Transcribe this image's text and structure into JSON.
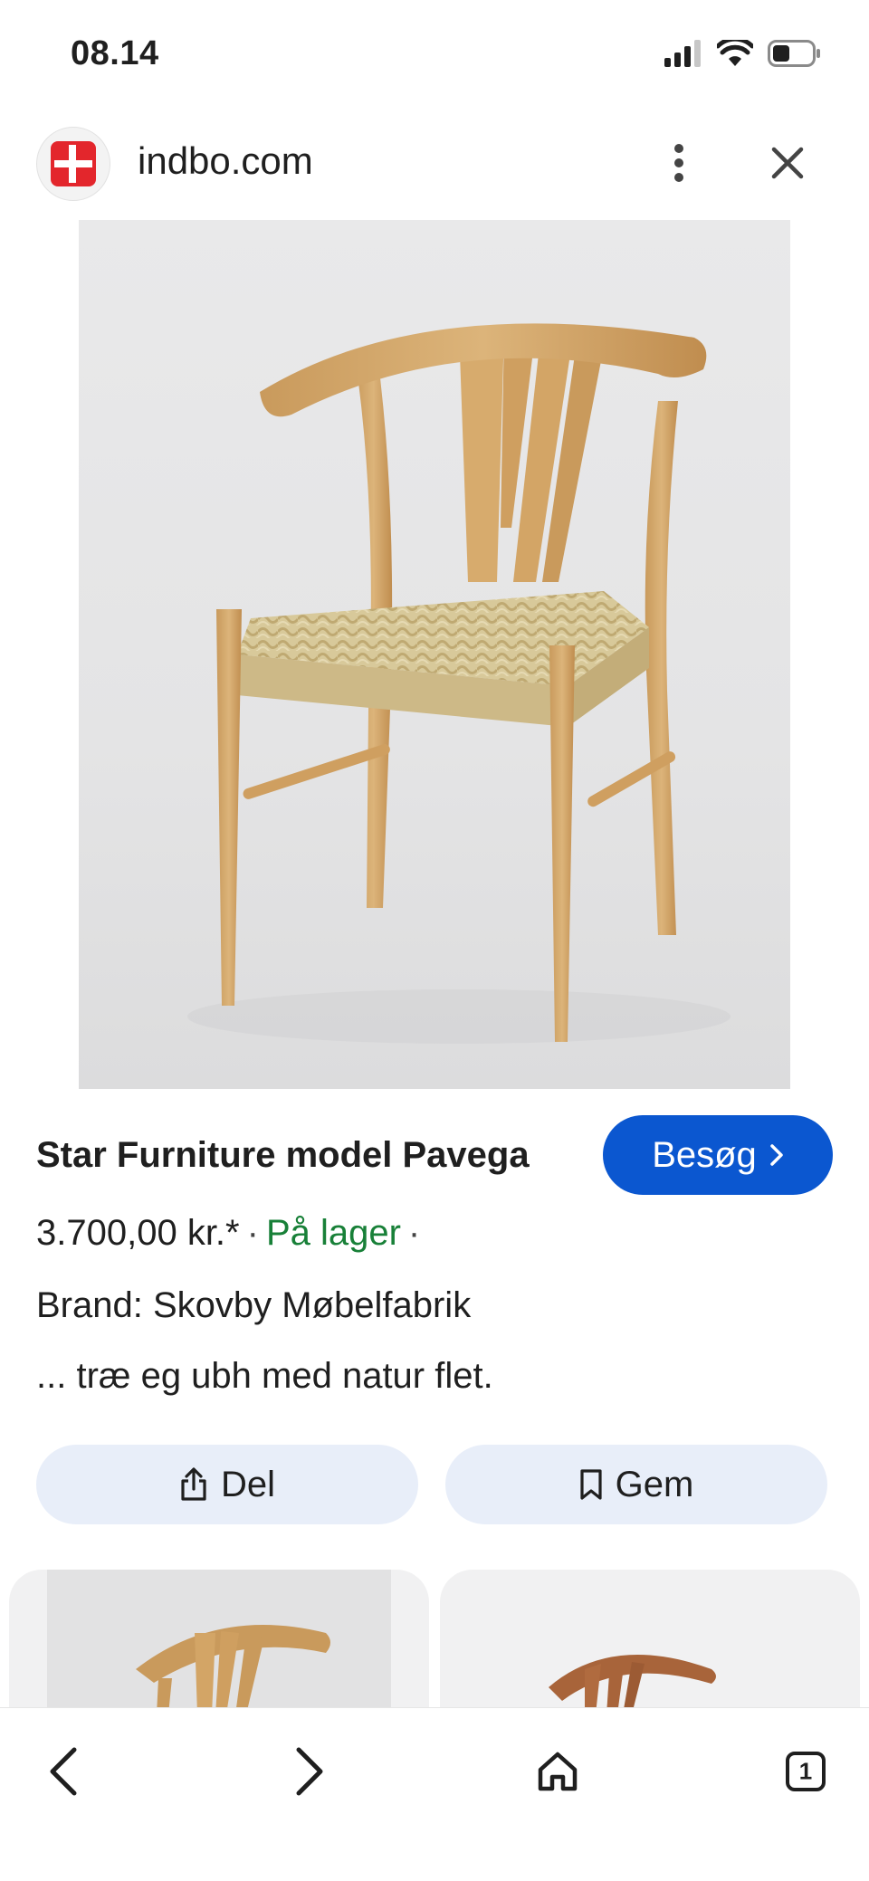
{
  "status_bar": {
    "time": "08.14"
  },
  "site": {
    "name": "indbo.com"
  },
  "product": {
    "title": "Star Furniture model Pavega",
    "visit_label": "Besøg",
    "price": "3.700,00 kr.*",
    "separator": "·",
    "stock": "På lager",
    "brand": "Brand: Skovby Møbelfabrik",
    "description": "... træ eg ubh med natur flet."
  },
  "actions": {
    "share_label": "Del",
    "save_label": "Gem"
  },
  "bottom_nav": {
    "tab_count": "1"
  },
  "colors": {
    "primary": "#0b57d0",
    "stock_green": "#188038",
    "action_bg": "#e8eef9",
    "logo_red": "#e3262c"
  },
  "icons": [
    "signal-icon",
    "wifi-icon",
    "battery-icon",
    "site-logo",
    "more-vert-icon",
    "close-icon",
    "chevron-right-icon",
    "share-icon",
    "bookmark-icon",
    "back-arrow-icon",
    "forward-arrow-icon",
    "home-icon",
    "tabs-icon"
  ]
}
